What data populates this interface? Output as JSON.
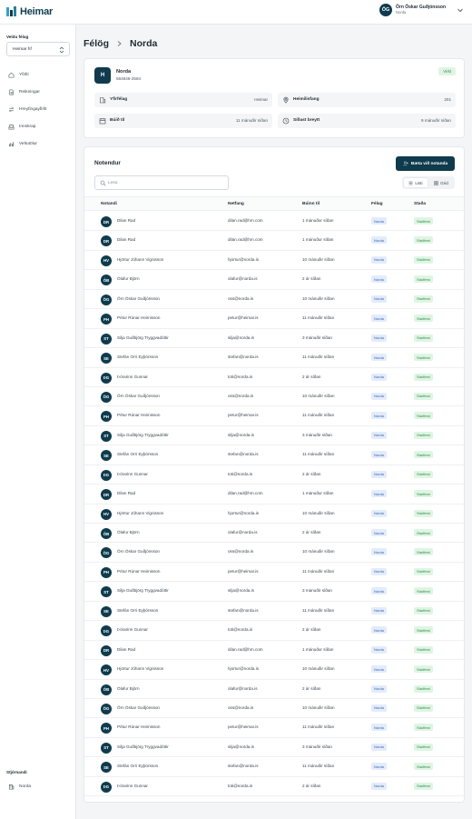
{
  "brand": {
    "name": "Heimar"
  },
  "user": {
    "initials": "ÖG",
    "name": "Örn Óskar Guðjónsson",
    "org": "Norda"
  },
  "sidebar": {
    "select_label": "Veldu félag",
    "selected_org": "Heimar hf",
    "nav": [
      {
        "label": "Yfirlit",
        "icon": "home-icon"
      },
      {
        "label": "Reikningar",
        "icon": "document-icon"
      },
      {
        "label": "Hreyfingayfirlit",
        "icon": "swap-icon"
      },
      {
        "label": "Innskrap",
        "icon": "inbox-icon"
      },
      {
        "label": "Veltutölur",
        "icon": "bar-chart-icon"
      }
    ],
    "admin_label": "Stjórnandi",
    "admin_item": "Norda"
  },
  "breadcrumb": {
    "parent": "Félög",
    "current": "Norda"
  },
  "org": {
    "initial": "H",
    "name": "Norda",
    "id": "584846-2584",
    "status": "Virkt",
    "fields": [
      {
        "label": "Yfirfélag",
        "value": "Heimar",
        "icon": "building-icon"
      },
      {
        "label": "Heimilisfang",
        "value": "201",
        "icon": "location-pin-icon"
      },
      {
        "label": "Búið til",
        "value": "11 mánuðir síðan",
        "icon": "calendar-icon"
      },
      {
        "label": "Síðast breytt",
        "value": "9 mánuðir síðan",
        "icon": "clock-icon"
      }
    ]
  },
  "users": {
    "title": "Notendur",
    "add_label": "Bæta við notanda",
    "search_placeholder": "Leita",
    "view_list": "Listi",
    "view_grid": "Grid",
    "columns": [
      "Notandi",
      "Netfang",
      "Búinn til",
      "Félag",
      "Staða"
    ],
    "rows": [
      {
        "initials": "DR",
        "name": "Dilan Rad",
        "email": "dilan.rad@hm.com",
        "created": "1 mánuður síðan",
        "org": "Norda",
        "status": "Staðfest"
      },
      {
        "initials": "DR",
        "name": "Dilan Rad",
        "email": "dilan.rad@hm.com",
        "created": "1 mánuður síðan",
        "org": "Norda",
        "status": "Staðfest"
      },
      {
        "initials": "HV",
        "name": "Hjörtur Jóhann Vignisson",
        "email": "hjortur@norda.is",
        "created": "10 mánuðir síðan",
        "org": "Norda",
        "status": "Staðfest"
      },
      {
        "initials": "ÓB",
        "name": "Ólafur Björn",
        "email": "olafur@norda.is",
        "created": "2 ár síðan",
        "org": "Norda",
        "status": "Staðfest"
      },
      {
        "initials": "ÖG",
        "name": "Örn Óskar Guðjónsson",
        "email": "oss@norda.is",
        "created": "10 mánuðir síðan",
        "org": "Norda",
        "status": "Staðfest"
      },
      {
        "initials": "PH",
        "name": "Pétur Rúnar Heimisson",
        "email": "petur@heimar.is",
        "created": "11 mánuðir síðan",
        "org": "Norda",
        "status": "Staðfest"
      },
      {
        "initials": "ST",
        "name": "Silja Guðbjörg Tryggvadóttir",
        "email": "silja@norda.is",
        "created": "3 mánuðir síðan",
        "org": "Norda",
        "status": "Staðfest"
      },
      {
        "initials": "SE",
        "name": "Stefán Orri Eyþórsson",
        "email": "stefan@norda.is",
        "created": "11 mánuðir síðan",
        "org": "Norda",
        "status": "Staðfest"
      },
      {
        "initials": "ÞG",
        "name": "Þórarinn Gunnar",
        "email": "toti@norda.is",
        "created": "2 ár síðan",
        "org": "Norda",
        "status": "Staðfest"
      },
      {
        "initials": "ÖG",
        "name": "Örn Óskar Guðjónsson",
        "email": "oss@norda.is",
        "created": "10 mánuðir síðan",
        "org": "Norda",
        "status": "Staðfest"
      },
      {
        "initials": "PH",
        "name": "Pétur Rúnar Heimisson",
        "email": "petur@heimar.is",
        "created": "11 mánuðir síðan",
        "org": "Norda",
        "status": "Staðfest"
      },
      {
        "initials": "ST",
        "name": "Silja Guðbjörg Tryggvadóttir",
        "email": "silja@norda.is",
        "created": "3 mánuðir síðan",
        "org": "Norda",
        "status": "Staðfest"
      },
      {
        "initials": "SE",
        "name": "Stefán Orri Eyþórsson",
        "email": "stefan@norda.is",
        "created": "11 mánuðir síðan",
        "org": "Norda",
        "status": "Staðfest"
      },
      {
        "initials": "ÞG",
        "name": "Þórarinn Gunnar",
        "email": "toti@norda.is",
        "created": "2 ár síðan",
        "org": "Norda",
        "status": "Staðfest"
      },
      {
        "initials": "DR",
        "name": "Dilan Rad",
        "email": "dilan.rad@hm.com",
        "created": "1 mánuður síðan",
        "org": "Norda",
        "status": "Staðfest"
      },
      {
        "initials": "HV",
        "name": "Hjörtur Jóhann Vignisson",
        "email": "hjortur@norda.is",
        "created": "10 mánuðir síðan",
        "org": "Norda",
        "status": "Staðfest"
      },
      {
        "initials": "ÓB",
        "name": "Ólafur Björn",
        "email": "olafur@norda.is",
        "created": "2 ár síðan",
        "org": "Norda",
        "status": "Staðfest"
      },
      {
        "initials": "ÖG",
        "name": "Örn Óskar Guðjónsson",
        "email": "oss@norda.is",
        "created": "10 mánuðir síðan",
        "org": "Norda",
        "status": "Staðfest"
      },
      {
        "initials": "PH",
        "name": "Pétur Rúnar Heimisson",
        "email": "petur@heimar.is",
        "created": "11 mánuðir síðan",
        "org": "Norda",
        "status": "Staðfest"
      },
      {
        "initials": "ST",
        "name": "Silja Guðbjörg Tryggvadóttir",
        "email": "silja@norda.is",
        "created": "3 mánuðir síðan",
        "org": "Norda",
        "status": "Staðfest"
      },
      {
        "initials": "SE",
        "name": "Stefán Orri Eyþórsson",
        "email": "stefan@norda.is",
        "created": "11 mánuðir síðan",
        "org": "Norda",
        "status": "Staðfest"
      },
      {
        "initials": "ÞG",
        "name": "Þórarinn Gunnar",
        "email": "toti@norda.is",
        "created": "2 ár síðan",
        "org": "Norda",
        "status": "Staðfest"
      },
      {
        "initials": "DR",
        "name": "Dilan Rad",
        "email": "dilan.rad@hm.com",
        "created": "1 mánuður síðan",
        "org": "Norda",
        "status": "Staðfest"
      },
      {
        "initials": "HV",
        "name": "Hjörtur Jóhann Vignisson",
        "email": "hjortur@norda.is",
        "created": "10 mánuðir síðan",
        "org": "Norda",
        "status": "Staðfest"
      },
      {
        "initials": "ÓB",
        "name": "Ólafur Björn",
        "email": "olafur@norda.is",
        "created": "2 ár síðan",
        "org": "Norda",
        "status": "Staðfest"
      },
      {
        "initials": "ÖG",
        "name": "Örn Óskar Guðjónsson",
        "email": "oss@norda.is",
        "created": "10 mánuðir síðan",
        "org": "Norda",
        "status": "Staðfest"
      },
      {
        "initials": "PH",
        "name": "Pétur Rúnar Heimisson",
        "email": "petur@heimar.is",
        "created": "11 mánuðir síðan",
        "org": "Norda",
        "status": "Staðfest"
      },
      {
        "initials": "ST",
        "name": "Silja Guðbjörg Tryggvadóttir",
        "email": "silja@norda.is",
        "created": "3 mánuðir síðan",
        "org": "Norda",
        "status": "Staðfest"
      },
      {
        "initials": "SE",
        "name": "Stefán Orri Eyþórsson",
        "email": "stefan@norda.is",
        "created": "11 mánuðir síðan",
        "org": "Norda",
        "status": "Staðfest"
      },
      {
        "initials": "ÞG",
        "name": "Þórarinn Gunnar",
        "email": "toti@norda.is",
        "created": "2 ár síðan",
        "org": "Norda",
        "status": "Staðfest"
      }
    ]
  },
  "colors": {
    "primary": "#0f3b4d",
    "success_bg": "#dff5e4",
    "success_text": "#2f8a45",
    "tag_bg": "#e3ecfb",
    "tag_text": "#3a63b8"
  }
}
